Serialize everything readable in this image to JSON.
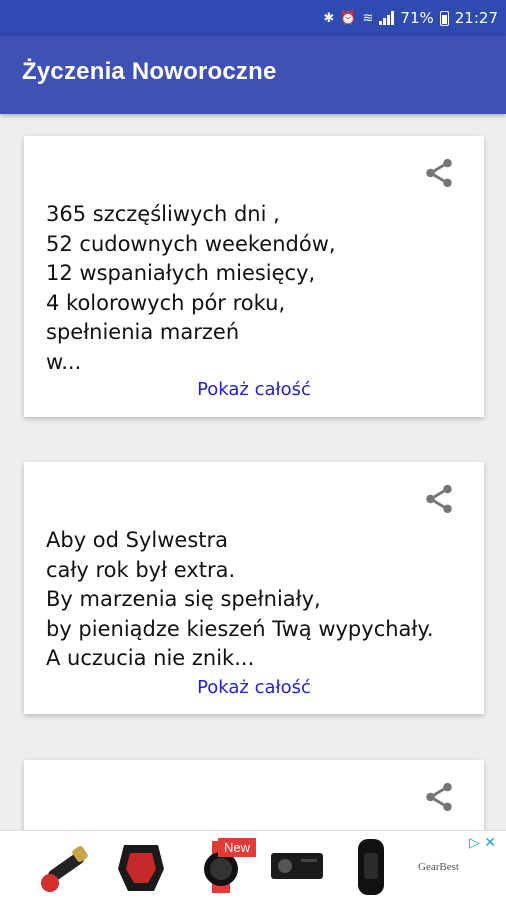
{
  "status_bar": {
    "battery": "71%",
    "time": "21:27"
  },
  "app_bar": {
    "title": "Życzenia Noworoczne"
  },
  "cards": [
    {
      "text": "365 szczęśliwych dni ,\n52 cudownych weekendów,\n12 wspaniałych miesięcy,\n4 kolorowych pór roku,\nspełnienia marzeń\nw...",
      "show_more": "Pokaż całość"
    },
    {
      "text": "Aby od Sylwestra\ncały rok był extra.\nBy marzenia się spełniały,\nby pieniądze kieszeń Twą wypychały.\nA uczucia nie znik...",
      "show_more": "Pokaż całość"
    },
    {
      "text": ""
    }
  ],
  "ad": {
    "badge": "New",
    "brand": "GearBest"
  },
  "colors": {
    "primary": "#3f51b5",
    "primary_dark": "#2f4ab0",
    "link": "#2222cc",
    "background": "#eeeeee"
  },
  "icons": [
    "bluetooth-icon",
    "alarm-icon",
    "wifi-icon",
    "signal-icon",
    "battery-icon",
    "share-icon",
    "ad-choices-icon"
  ]
}
